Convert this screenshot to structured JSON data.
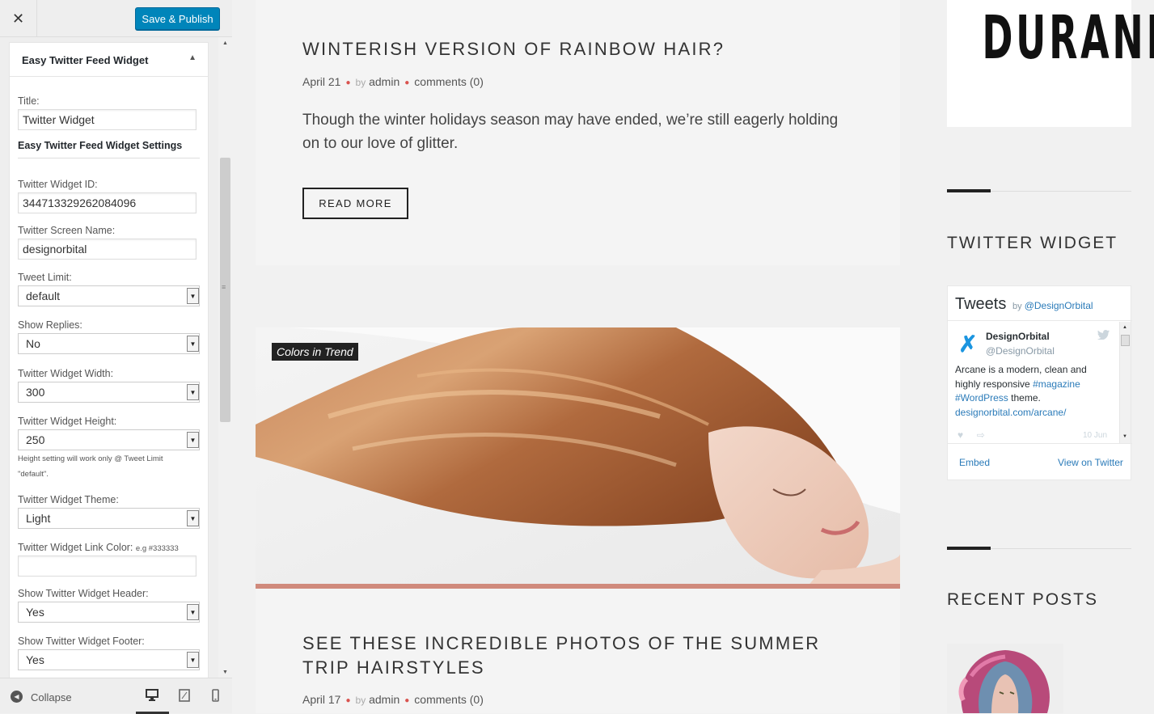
{
  "customizer": {
    "close_glyph": "✕",
    "publish_label": "Save & Publish",
    "widget_title": "Easy Twitter Feed Widget",
    "collapse_arrow": "▲",
    "fields": {
      "title_label": "Title:",
      "title_value": "Twitter Widget",
      "settings_heading": "Easy Twitter Feed Widget Settings",
      "widget_id_label": "Twitter Widget ID:",
      "widget_id_value": "344713329262084096",
      "screen_name_label": "Twitter Screen Name:",
      "screen_name_value": "designorbital",
      "tweet_limit_label": "Tweet Limit:",
      "tweet_limit_value": "default",
      "show_replies_label": "Show Replies:",
      "show_replies_value": "No",
      "width_label": "Twitter Widget Width:",
      "width_value": "300",
      "height_label": "Twitter Widget Height:",
      "height_value": "250",
      "height_hint": "Height setting will work only @ Tweet Limit \"default\".",
      "theme_label": "Twitter Widget Theme:",
      "theme_value": "Light",
      "link_color_label": "Twitter Widget Link Color:",
      "link_color_hint": "e.g #333333",
      "link_color_value": "",
      "show_header_label": "Show Twitter Widget Header:",
      "show_header_value": "Yes",
      "show_footer_label": "Show Twitter Widget Footer:",
      "show_footer_value": "Yes"
    },
    "footer": {
      "collapse_label": "Collapse"
    }
  },
  "preview": {
    "post1": {
      "title": "WINTERISH VERSION OF RAINBOW HAIR?",
      "date": "April 21",
      "by": "by",
      "author": "admin",
      "comments": "comments (0)",
      "excerpt": "Though the winter holidays season may have ended, we’re still eagerly holding on to our love of glitter.",
      "read_more": "READ MORE"
    },
    "post2": {
      "category": "Colors in Trend",
      "title": "SEE THESE INCREDIBLE PHOTOS OF THE SUMMER TRIP HAIRSTYLES",
      "date": "April 17",
      "by": "by",
      "author": "admin",
      "comments": "comments (0)"
    },
    "sidebar": {
      "logo": "DURAND",
      "twitter_heading": "TWITTER WIDGET",
      "recent_heading": "RECENT POSTS",
      "twitter": {
        "title": "Tweets",
        "by": "by",
        "by_handle": "@DesignOrbital",
        "name": "DesignOrbital",
        "handle": "@DesignOrbital",
        "text_pre": "Arcane is a modern, clean and highly responsive",
        "tag1": "#magazine",
        "tag2": "#WordPress",
        "text_post": "theme.",
        "link": "designorbital.com/arcane/",
        "date": "10 Jun",
        "embed": "Embed",
        "view": "View on Twitter"
      }
    }
  },
  "colors": {
    "publish_button": "#0085ba",
    "accent_bar": "#d08a7c",
    "twitter_link": "#2b7bb9",
    "meta_dot": "#d9534f"
  },
  "icons": [
    "close-icon",
    "chevron-up-icon",
    "dropdown-arrow-icon",
    "collapse-icon",
    "desktop-icon",
    "tablet-icon",
    "mobile-icon",
    "twitter-bird-icon",
    "heart-icon",
    "retweet-icon"
  ]
}
